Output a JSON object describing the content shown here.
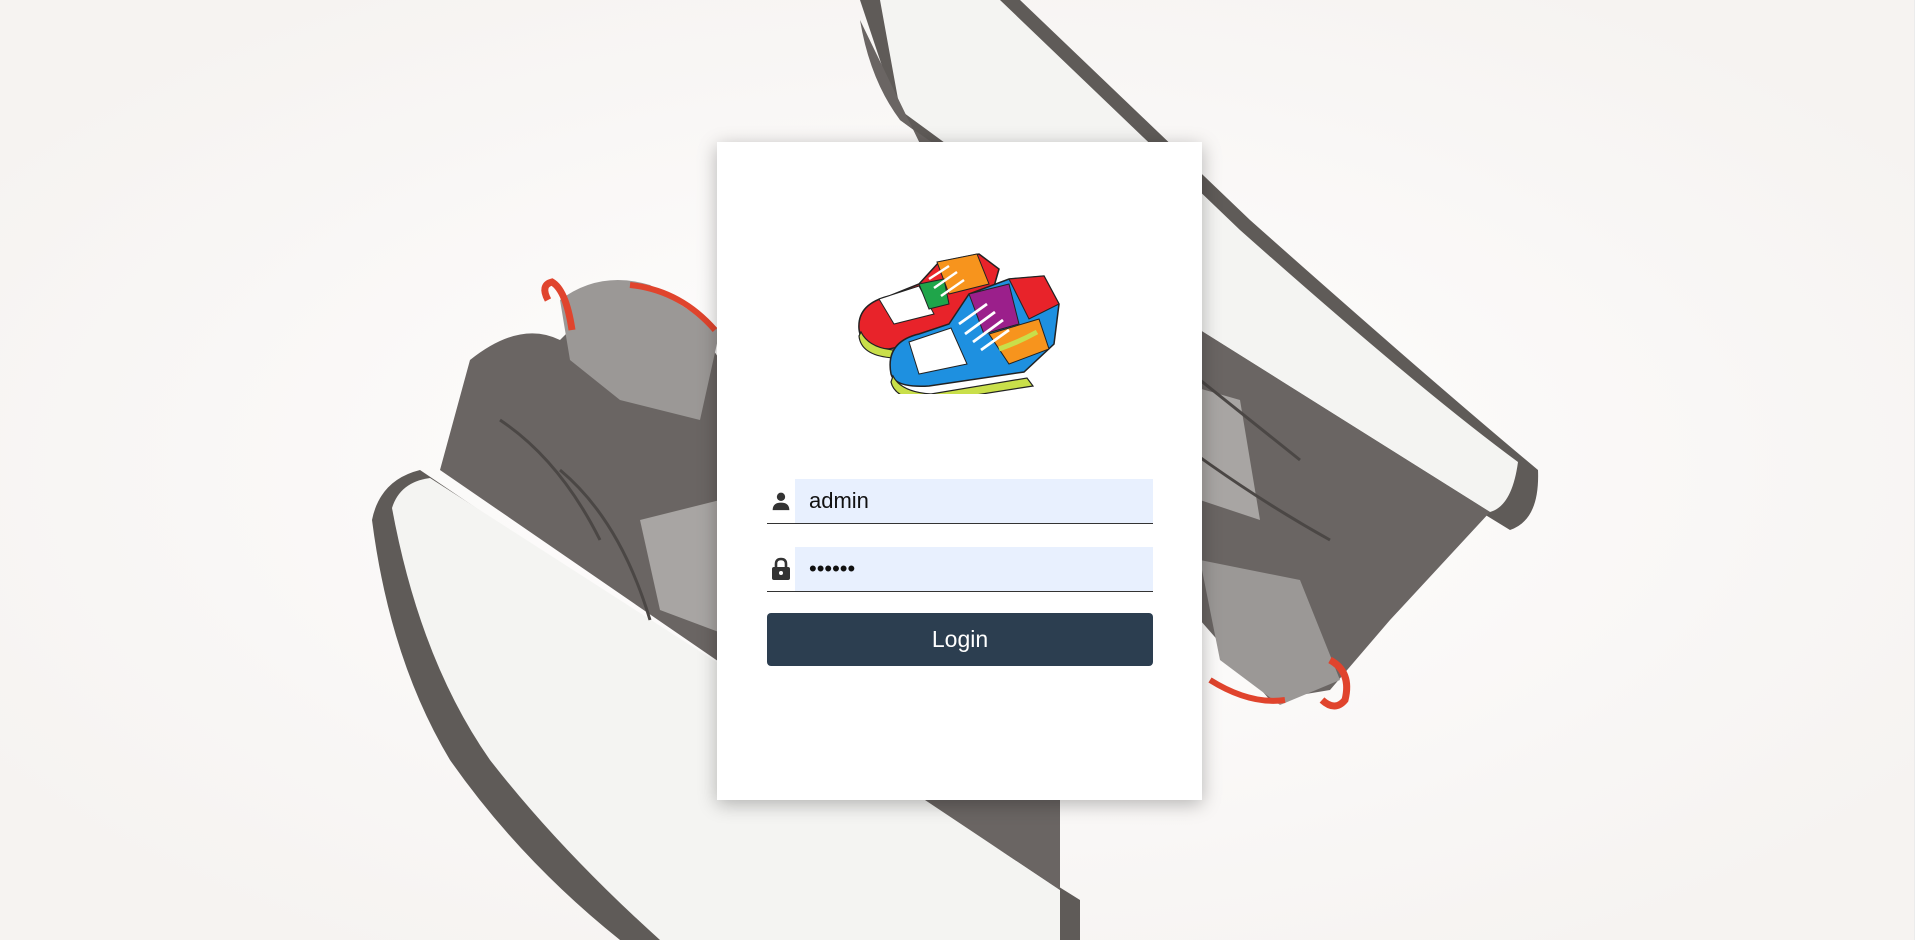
{
  "login": {
    "username_value": "admin",
    "password_value": "••••••",
    "button_label": "Login"
  },
  "icons": {
    "user": "user-icon",
    "password": "lock-icon",
    "logo": "sneaker-logo"
  },
  "colors": {
    "button_bg": "#2c3e50",
    "button_text": "#ffffff",
    "input_bg": "#e8f0fe"
  }
}
